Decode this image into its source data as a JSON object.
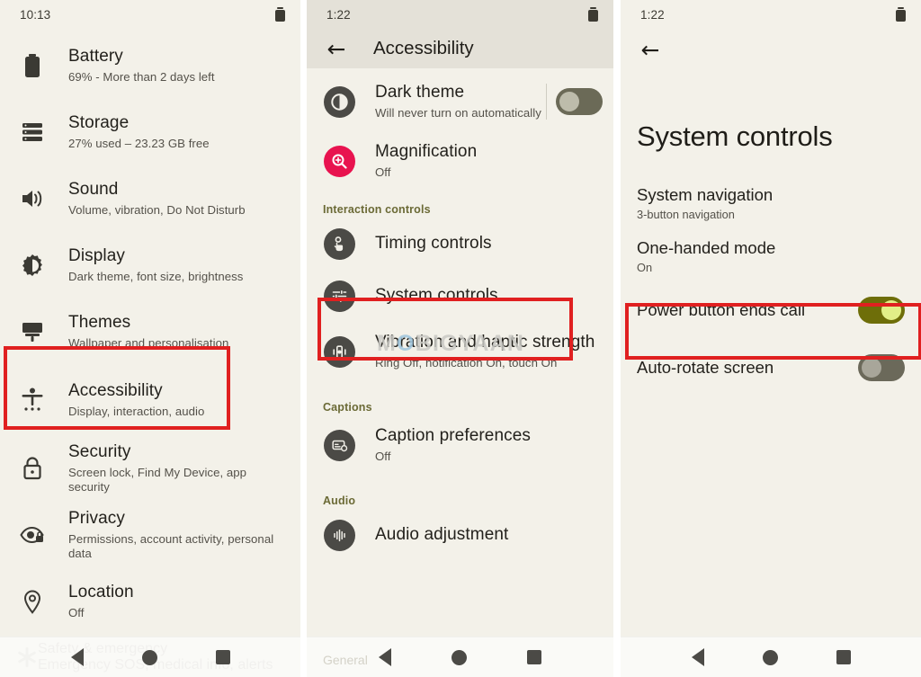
{
  "panel1": {
    "statusbar": {
      "clock": "10:13",
      "battery_icon": "battery-icon"
    },
    "items": [
      {
        "icon": "battery-icon",
        "title": "Battery",
        "sub": "69% - More than 2 days left"
      },
      {
        "icon": "storage-icon",
        "title": "Storage",
        "sub": "27% used – 23.23 GB free"
      },
      {
        "icon": "sound-icon",
        "title": "Sound",
        "sub": "Volume, vibration, Do Not Disturb"
      },
      {
        "icon": "display-icon",
        "title": "Display",
        "sub": "Dark theme, font size, brightness"
      },
      {
        "icon": "themes-icon",
        "title": "Themes",
        "sub": "Wallpaper and personalisation"
      },
      {
        "icon": "accessibility-icon",
        "title": "Accessibility",
        "sub": "Display, interaction, audio"
      },
      {
        "icon": "security-icon",
        "title": "Security",
        "sub": "Screen lock, Find My Device, app security"
      },
      {
        "icon": "privacy-icon",
        "title": "Privacy",
        "sub": "Permissions, account activity, personal data"
      },
      {
        "icon": "location-icon",
        "title": "Location",
        "sub": "Off"
      },
      {
        "icon": "safety-icon",
        "title": "Safety & emergency",
        "sub": "Emergency SOS, medical info, alerts"
      }
    ],
    "highlight": "Accessibility"
  },
  "panel2": {
    "statusbar": {
      "clock": "1:22",
      "battery_icon": "battery-icon"
    },
    "appbar": {
      "back": "back-arrow-icon",
      "title": "Accessibility"
    },
    "items": [
      {
        "icon": "contrast-icon",
        "title": "Dark theme",
        "sub": "Will never turn on automatically",
        "toggle": "off"
      },
      {
        "icon": "magnify-icon",
        "title": "Magnification",
        "sub": "Off"
      }
    ],
    "sections": [
      {
        "label": "Interaction controls",
        "items": [
          {
            "icon": "timing-controls-icon",
            "title": "Timing controls",
            "sub": ""
          },
          {
            "icon": "sliders-icon",
            "title": "System controls",
            "sub": ""
          },
          {
            "icon": "vibration-icon",
            "title": "Vibration and haptic strength",
            "sub": "Ring Off, notification On, touch On"
          }
        ]
      },
      {
        "label": "Captions",
        "items": [
          {
            "icon": "caption-icon",
            "title": "Caption preferences",
            "sub": "Off"
          }
        ]
      },
      {
        "label": "Audio",
        "items": [
          {
            "icon": "audio-wave-icon",
            "title": "Audio adjustment",
            "sub": ""
          }
        ]
      }
    ],
    "faded_label": "General",
    "watermark": {
      "before": "M",
      "o": "O",
      "after": "BIGYAAN"
    },
    "highlight": "System controls"
  },
  "panel3": {
    "statusbar": {
      "clock": "1:22",
      "battery_icon": "battery-icon"
    },
    "back": "back-arrow-icon",
    "title": "System controls",
    "items": [
      {
        "title": "System navigation",
        "sub": "3-button navigation",
        "toggle": null
      },
      {
        "title": "One-handed mode",
        "sub": "On",
        "toggle": null
      },
      {
        "title": "Power button ends call",
        "sub": "",
        "toggle": "on"
      },
      {
        "title": "Auto-rotate screen",
        "sub": "",
        "toggle": "off"
      }
    ],
    "highlight": "Power button ends call"
  },
  "navbar": {
    "back": "nav-back-icon",
    "home": "nav-home-icon",
    "recents": "nav-recents-icon"
  },
  "colors": {
    "background": "#f3f1e9",
    "appbar": "#e4e1d8",
    "highlight_red": "#e02020",
    "accent_pink": "#e8134f",
    "chip_dark": "#4b4a46",
    "toggle_on": "#6e6e09",
    "toggle_on_knob": "#e2ef87",
    "section_label": "#6b6a36"
  }
}
